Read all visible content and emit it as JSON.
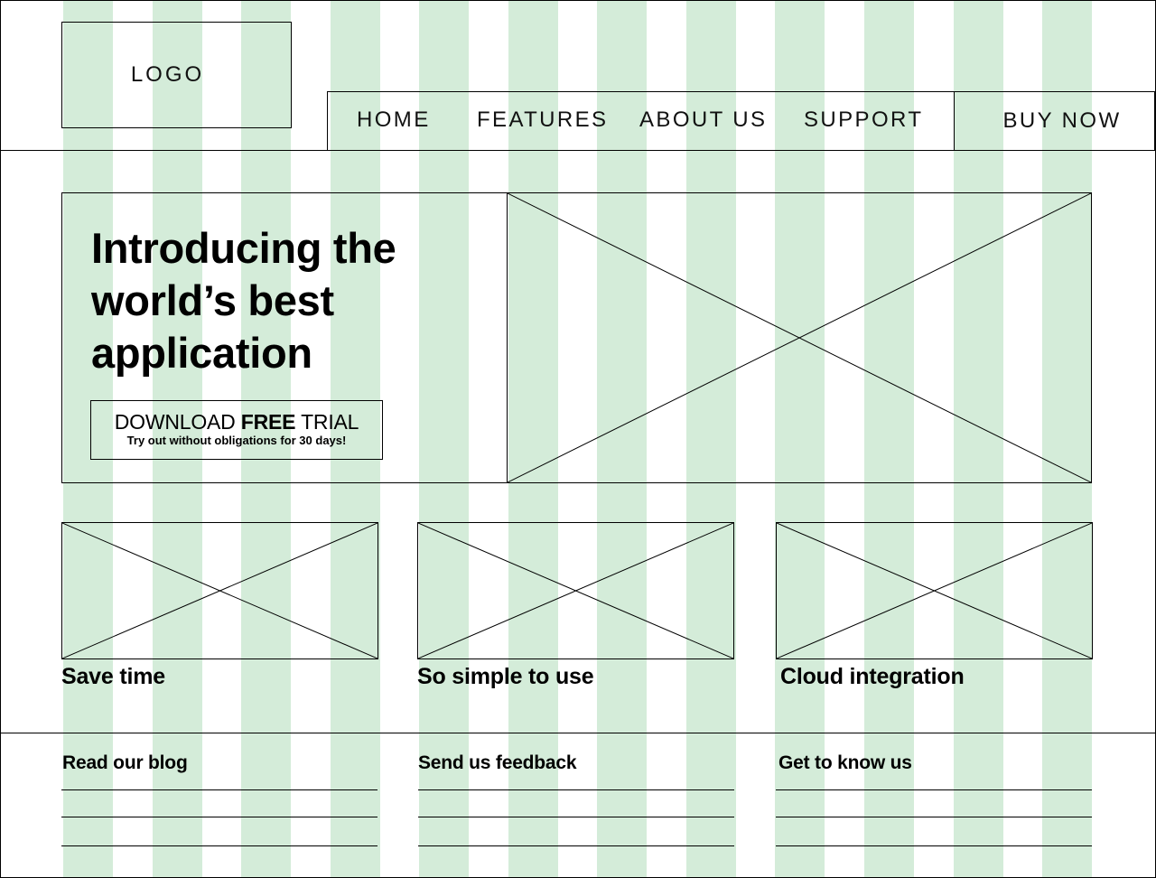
{
  "grid": {
    "column_count": 12,
    "stripe_color": "#d4ecd9"
  },
  "header": {
    "logo_label": "LOGO",
    "nav": [
      {
        "label": "HOME"
      },
      {
        "label": "FEATURES"
      },
      {
        "label": "ABOUT US"
      },
      {
        "label": "SUPPORT"
      }
    ],
    "buy_button_label": "BUY NOW"
  },
  "hero": {
    "title_line1": "Introducing the",
    "title_line2": "world’s best",
    "title_line3": "application",
    "cta": {
      "prefix": "DOWNLOAD ",
      "emphasis": "FREE",
      "suffix": " TRIAL",
      "subtitle": "Try out without obligations for 30 days!"
    },
    "image_icon": "image-placeholder-icon"
  },
  "features": [
    {
      "title": "Save time",
      "image_icon": "image-placeholder-icon"
    },
    {
      "title": "So simple to use",
      "image_icon": "image-placeholder-icon"
    },
    {
      "title": "Cloud integration",
      "image_icon": "image-placeholder-icon"
    }
  ],
  "footer": {
    "columns": [
      {
        "title": "Read our blog",
        "line_count": 3
      },
      {
        "title": "Send us feedback",
        "line_count": 3
      },
      {
        "title": "Get to know us",
        "line_count": 3
      }
    ]
  }
}
